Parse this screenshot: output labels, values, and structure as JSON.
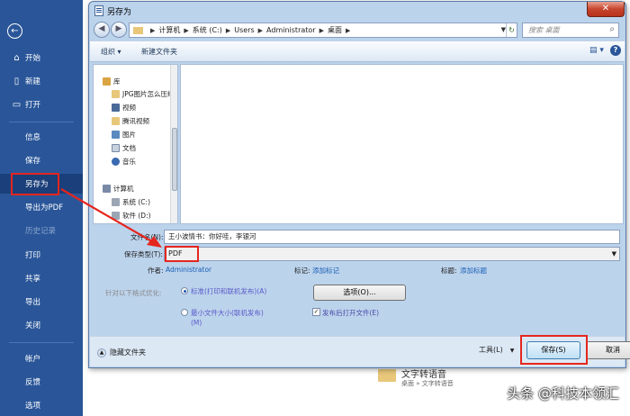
{
  "sidebar": {
    "back_icon": "back-arrow-icon",
    "items": [
      {
        "label": "开始",
        "icon": "home-icon"
      },
      {
        "label": "新建",
        "icon": "new-doc-icon"
      },
      {
        "label": "打开",
        "icon": "open-folder-icon"
      },
      {
        "label": "信息"
      },
      {
        "label": "保存"
      },
      {
        "label": "另存为"
      },
      {
        "label": "导出为PDF"
      },
      {
        "label": "历史记录"
      },
      {
        "label": "打印"
      },
      {
        "label": "共享"
      },
      {
        "label": "导出"
      },
      {
        "label": "关闭"
      },
      {
        "label": "帐户"
      },
      {
        "label": "反馈"
      },
      {
        "label": "选项"
      }
    ],
    "selected": "另存为",
    "disabled": "历史记录"
  },
  "backstage": {
    "recent_folder_name": "文字转语音",
    "recent_folder_path": "桌面 » 文字转语音",
    "watermark": "头条 @科技本领汇"
  },
  "dialog": {
    "title": "另存为",
    "close_label": "✕",
    "address": {
      "crumbs": [
        "计算机",
        "系统 (C:)",
        "Users",
        "Administrator",
        "桌面"
      ]
    },
    "search_placeholder": "搜索 桌面",
    "toolbar": {
      "organize": "组织 ▾",
      "new_folder": "新建文件夹"
    },
    "nav_pane": {
      "items": [
        {
          "label": "库",
          "icon": "library-icon",
          "color": "#d9a441"
        },
        {
          "label": "JPG图片怎么压缩",
          "icon": "folder-icon",
          "color": "#e8c77a"
        },
        {
          "label": "视频",
          "icon": "video-icon",
          "color": "#4a6a98"
        },
        {
          "label": "腾讯视频",
          "icon": "folder-icon",
          "color": "#e8c77a"
        },
        {
          "label": "图片",
          "icon": "pictures-icon",
          "color": "#5a8ac0"
        },
        {
          "label": "文档",
          "icon": "document-icon",
          "color": "#c8d2de"
        },
        {
          "label": "音乐",
          "icon": "music-icon",
          "color": "#3a6ab0"
        },
        {
          "label": "计算机",
          "icon": "computer-icon",
          "color": "#7a8aa6"
        },
        {
          "label": "系统 (C:)",
          "icon": "drive-icon",
          "color": "#9aa6b4"
        },
        {
          "label": "软件 (D:)",
          "icon": "drive-icon",
          "color": "#9aa6b4"
        }
      ]
    },
    "form": {
      "filename_label": "文件名(N):",
      "filename_value": "王小波情书：你好哇，李银河",
      "filetype_label": "保存类型(T):",
      "filetype_value": "PDF",
      "author_label": "作者:",
      "author_value": "Administrator",
      "tags_label": "标记:",
      "tags_value": "添加标记",
      "title_label": "标题:",
      "title_value": "添加标题",
      "optimize_label": "针对以下格式优化:",
      "optimize_options": [
        {
          "label": "标准(打印和联机发布)(A)",
          "checked": true
        },
        {
          "label": "最小文件大小(联机发布)(M)",
          "checked": false
        }
      ],
      "options_button": "选项(O)...",
      "open_after_label": "发布后打开文件(E)",
      "open_after_checked": true
    },
    "footer": {
      "hide_folders": "隐藏文件夹",
      "tools": "工具(L)",
      "save": "保存(S)",
      "cancel": "取消"
    }
  },
  "colors": {
    "sidebar_bg": "#2a5699",
    "highlight_red": "#e5261e",
    "link_blue": "#1a5fb4"
  }
}
